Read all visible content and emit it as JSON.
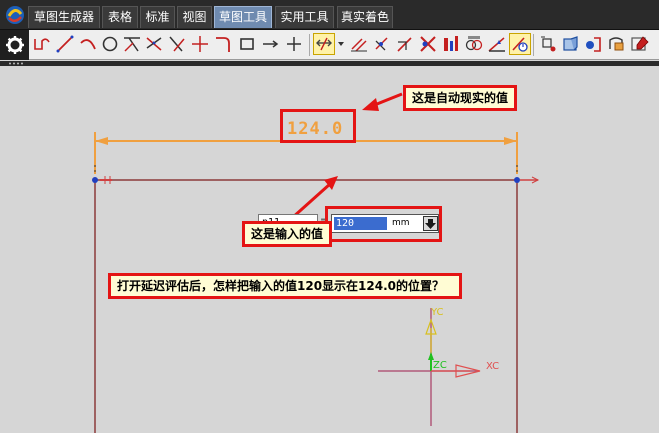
{
  "menu": {
    "tabs": [
      {
        "label": "草图生成器"
      },
      {
        "label": "表格"
      },
      {
        "label": "标准"
      },
      {
        "label": "视图"
      },
      {
        "label": "草图工具"
      },
      {
        "label": "实用工具"
      },
      {
        "label": "真实着色"
      }
    ],
    "active_tab": "草图工具"
  },
  "toolbar": {
    "icons": [
      "profile-icon",
      "line-icon",
      "arc-icon",
      "circle-icon",
      "quick-trim-icon",
      "quick-extend-icon",
      "make-corner-icon",
      "fillet-icon",
      "rectangle-icon",
      "point-icon",
      "auto-dimension-icon",
      "geometric-constraints-icon",
      "display-constraints-icon",
      "convert-reference-icon",
      "animate-dimension-icon",
      "alternate-solution-icon",
      "inferred-constraints-icon",
      "create-inferred-icon",
      "delay-evaluation-icon",
      "evaluate-sketch-icon",
      "update-model-icon",
      "perimeter-dimension-icon",
      "show-all-icon"
    ],
    "selected_icon": "auto-dimension-icon"
  },
  "sketch": {
    "dimension_value": "124.0",
    "expression_name": "p11",
    "equals": "=",
    "input_value": "120",
    "unit": "mm"
  },
  "annotations": {
    "auto_value_note": "这是自动现实的值",
    "input_value_note": "这是输入的值",
    "question": "打开延迟评估后，怎样把输入的值120显示在124.0的位置？"
  },
  "axes": {
    "y_label": "YC",
    "x_label": "XC",
    "z_label": "ZC"
  },
  "colors": {
    "dimension": "#f0a040",
    "sketch_line": "#8b3a3a",
    "callout_border": "#e41414",
    "callout_bg": "#fffcd4",
    "axis_y": "#e0c020",
    "axis_z": "#20c020",
    "axis_x": "#e05050",
    "active_tab": "#6f8bb0"
  }
}
